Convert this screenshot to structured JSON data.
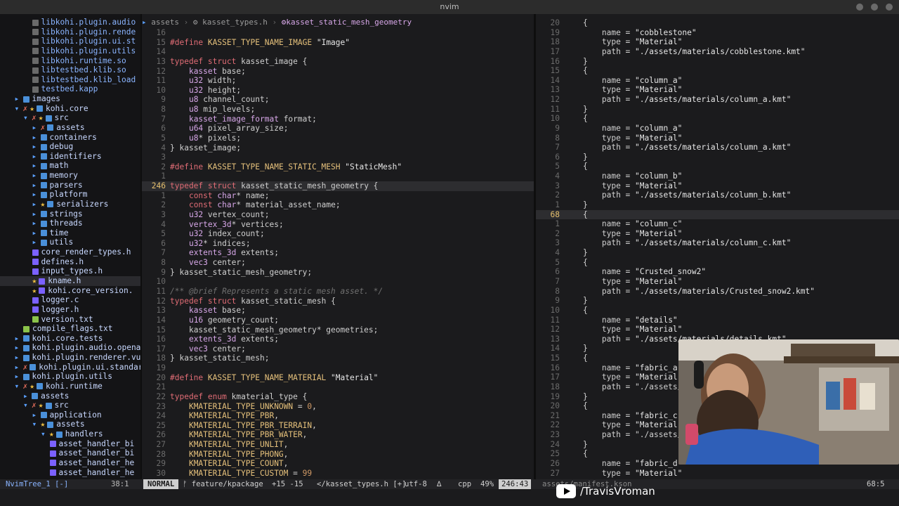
{
  "window": {
    "title": "nvim",
    "accent": "#e6c06e"
  },
  "tree": {
    "items": [
      {
        "indent": 3,
        "kind": "so",
        "label": "libkohi.plugin.audio"
      },
      {
        "indent": 3,
        "kind": "so",
        "label": "libkohi.plugin.rende"
      },
      {
        "indent": 3,
        "kind": "so",
        "label": "libkohi.plugin.ui.st"
      },
      {
        "indent": 3,
        "kind": "so",
        "label": "libkohi.plugin.utils"
      },
      {
        "indent": 3,
        "kind": "so",
        "label": "libkohi.runtime.so"
      },
      {
        "indent": 3,
        "kind": "so",
        "label": "libtestbed.klib.so"
      },
      {
        "indent": 3,
        "kind": "so",
        "label": "libtestbed.klib_load"
      },
      {
        "indent": 3,
        "kind": "so",
        "label": "testbed.kapp"
      },
      {
        "indent": 1,
        "kind": "dir",
        "label": "images",
        "chev": "▸"
      },
      {
        "indent": 1,
        "kind": "dir",
        "label": "kohi.core",
        "chev": "▾",
        "mark": "✗★"
      },
      {
        "indent": 2,
        "kind": "dir",
        "label": "src",
        "chev": "▾",
        "mark": "✗★"
      },
      {
        "indent": 3,
        "kind": "dir",
        "label": "assets",
        "chev": "▸",
        "mark": "✗"
      },
      {
        "indent": 3,
        "kind": "dir",
        "label": "containers",
        "chev": "▸"
      },
      {
        "indent": 3,
        "kind": "dir",
        "label": "debug",
        "chev": "▸"
      },
      {
        "indent": 3,
        "kind": "dir",
        "label": "identifiers",
        "chev": "▸"
      },
      {
        "indent": 3,
        "kind": "dir",
        "label": "math",
        "chev": "▸"
      },
      {
        "indent": 3,
        "kind": "dir",
        "label": "memory",
        "chev": "▸"
      },
      {
        "indent": 3,
        "kind": "dir",
        "label": "parsers",
        "chev": "▸"
      },
      {
        "indent": 3,
        "kind": "dir",
        "label": "platform",
        "chev": "▸"
      },
      {
        "indent": 3,
        "kind": "dir",
        "label": "serializers",
        "chev": "▸",
        "mark": "★"
      },
      {
        "indent": 3,
        "kind": "dir",
        "label": "strings",
        "chev": "▸"
      },
      {
        "indent": 3,
        "kind": "dir",
        "label": "threads",
        "chev": "▸"
      },
      {
        "indent": 3,
        "kind": "dir",
        "label": "time",
        "chev": "▸"
      },
      {
        "indent": 3,
        "kind": "dir",
        "label": "utils",
        "chev": "▸"
      },
      {
        "indent": 3,
        "kind": "h",
        "label": "core_render_types.h"
      },
      {
        "indent": 3,
        "kind": "h",
        "label": "defines.h"
      },
      {
        "indent": 3,
        "kind": "h",
        "label": "input_types.h"
      },
      {
        "indent": 3,
        "kind": "h",
        "label": "kname.h",
        "mark": "★",
        "sel": true
      },
      {
        "indent": 3,
        "kind": "h",
        "label": "kohi.core_version.",
        "mark": "★"
      },
      {
        "indent": 3,
        "kind": "c",
        "label": "logger.c"
      },
      {
        "indent": 3,
        "kind": "h",
        "label": "logger.h"
      },
      {
        "indent": 3,
        "kind": "txt",
        "label": "version.txt"
      },
      {
        "indent": 2,
        "kind": "txt",
        "label": "compile_flags.txt"
      },
      {
        "indent": 1,
        "kind": "dir",
        "label": "kohi.core.tests",
        "chev": "▸"
      },
      {
        "indent": 1,
        "kind": "dir",
        "label": "kohi.plugin.audio.openal",
        "chev": "▸"
      },
      {
        "indent": 1,
        "kind": "dir",
        "label": "kohi.plugin.renderer.vul",
        "chev": "▸"
      },
      {
        "indent": 1,
        "kind": "dir",
        "label": "kohi.plugin.ui.standar",
        "chev": "▸",
        "mark": "✗"
      },
      {
        "indent": 1,
        "kind": "dir",
        "label": "kohi.plugin.utils",
        "chev": "▸"
      },
      {
        "indent": 1,
        "kind": "dir",
        "label": "kohi.runtime",
        "chev": "▾",
        "mark": "✗★"
      },
      {
        "indent": 2,
        "kind": "dir",
        "label": "assets",
        "chev": "▸"
      },
      {
        "indent": 2,
        "kind": "dir",
        "label": "src",
        "chev": "▾",
        "mark": "✗★"
      },
      {
        "indent": 3,
        "kind": "dir",
        "label": "application",
        "chev": "▸"
      },
      {
        "indent": 3,
        "kind": "dir",
        "label": "assets",
        "chev": "▾",
        "mark": "★"
      },
      {
        "indent": 4,
        "kind": "dir",
        "label": "handlers",
        "chev": "▾",
        "mark": "★"
      },
      {
        "indent": 5,
        "kind": "c",
        "label": "asset_handler_bi"
      },
      {
        "indent": 5,
        "kind": "c",
        "label": "asset_handler_bi"
      },
      {
        "indent": 5,
        "kind": "c",
        "label": "asset_handler_he"
      },
      {
        "indent": 5,
        "kind": "c",
        "label": "asset_handler_he"
      }
    ]
  },
  "left_editor": {
    "breadcrumb": [
      "assets",
      "kasset_types.h",
      "kasset_static_mesh_geometry"
    ],
    "lines": [
      {
        "n": "16",
        "code": ""
      },
      {
        "n": "15",
        "code": "#define KASSET_TYPE_NAME_IMAGE \"Image\""
      },
      {
        "n": "14",
        "code": ""
      },
      {
        "n": "13",
        "code": "typedef struct kasset_image {"
      },
      {
        "n": "12",
        "code": "    kasset base;"
      },
      {
        "n": "11",
        "code": "    u32 width;"
      },
      {
        "n": "10",
        "code": "    u32 height;"
      },
      {
        "n": "9",
        "code": "    u8 channel_count;"
      },
      {
        "n": "8",
        "code": "    u8 mip_levels;"
      },
      {
        "n": "7",
        "code": "    kasset_image_format format;"
      },
      {
        "n": "6",
        "code": "    u64 pixel_array_size;"
      },
      {
        "n": "5",
        "code": "    u8* pixels;"
      },
      {
        "n": "4",
        "code": "} kasset_image;"
      },
      {
        "n": "3",
        "code": ""
      },
      {
        "n": "2",
        "code": "#define KASSET_TYPE_NAME_STATIC_MESH \"StaticMesh\""
      },
      {
        "n": "1",
        "code": ""
      },
      {
        "n": "246",
        "code": "typedef struct kasset_static_mesh_geometry {",
        "cur": true
      },
      {
        "n": "1",
        "code": "    const char* name;"
      },
      {
        "n": "2",
        "code": "    const char* material_asset_name;"
      },
      {
        "n": "3",
        "code": "    u32 vertex_count;"
      },
      {
        "n": "4",
        "code": "    vertex_3d* vertices;"
      },
      {
        "n": "5",
        "code": "    u32 index_count;"
      },
      {
        "n": "6",
        "code": "    u32* indices;"
      },
      {
        "n": "7",
        "code": "    extents_3d extents;"
      },
      {
        "n": "8",
        "code": "    vec3 center;"
      },
      {
        "n": "9",
        "code": "} kasset_static_mesh_geometry;"
      },
      {
        "n": "10",
        "code": ""
      },
      {
        "n": "11",
        "code": "/** @brief Represents a static mesh asset. */"
      },
      {
        "n": "12",
        "code": "typedef struct kasset_static_mesh {"
      },
      {
        "n": "13",
        "code": "    kasset base;"
      },
      {
        "n": "14",
        "code": "    u16 geometry_count;"
      },
      {
        "n": "15",
        "code": "    kasset_static_mesh_geometry* geometries;"
      },
      {
        "n": "16",
        "code": "    extents_3d extents;"
      },
      {
        "n": "17",
        "code": "    vec3 center;"
      },
      {
        "n": "18",
        "code": "} kasset_static_mesh;"
      },
      {
        "n": "19",
        "code": ""
      },
      {
        "n": "20",
        "code": "#define KASSET_TYPE_NAME_MATERIAL \"Material\""
      },
      {
        "n": "21",
        "code": ""
      },
      {
        "n": "22",
        "code": "typedef enum kmaterial_type {"
      },
      {
        "n": "23",
        "code": "    KMATERIAL_TYPE_UNKNOWN = 0,"
      },
      {
        "n": "24",
        "code": "    KMATERIAL_TYPE_PBR,"
      },
      {
        "n": "25",
        "code": "    KMATERIAL_TYPE_PBR_TERRAIN,"
      },
      {
        "n": "26",
        "code": "    KMATERIAL_TYPE_PBR_WATER,"
      },
      {
        "n": "27",
        "code": "    KMATERIAL_TYPE_UNLIT,"
      },
      {
        "n": "28",
        "code": "    KMATERIAL_TYPE_PHONG,"
      },
      {
        "n": "29",
        "code": "    KMATERIAL_TYPE_COUNT,"
      },
      {
        "n": "30",
        "code": "    KMATERIAL_TYPE_CUSTOM = 99"
      }
    ]
  },
  "right_editor": {
    "lines": [
      {
        "n": "20",
        "code": "    {"
      },
      {
        "n": "19",
        "code": "        name = \"cobblestone\""
      },
      {
        "n": "18",
        "code": "        type = \"Material\""
      },
      {
        "n": "17",
        "code": "        path = \"./assets/materials/cobblestone.kmt\""
      },
      {
        "n": "16",
        "code": "    }"
      },
      {
        "n": "15",
        "code": "    {"
      },
      {
        "n": "14",
        "code": "        name = \"column_a\""
      },
      {
        "n": "13",
        "code": "        type = \"Material\""
      },
      {
        "n": "12",
        "code": "        path = \"./assets/materials/column_a.kmt\""
      },
      {
        "n": "11",
        "code": "    }"
      },
      {
        "n": "10",
        "code": "    {"
      },
      {
        "n": "9",
        "code": "        name = \"column_a\""
      },
      {
        "n": "8",
        "code": "        type = \"Material\""
      },
      {
        "n": "7",
        "code": "        path = \"./assets/materials/column_a.kmt\""
      },
      {
        "n": "6",
        "code": "    }"
      },
      {
        "n": "5",
        "code": "    {"
      },
      {
        "n": "4",
        "code": "        name = \"column_b\""
      },
      {
        "n": "3",
        "code": "        type = \"Material\""
      },
      {
        "n": "2",
        "code": "        path = \"./assets/materials/column_b.kmt\""
      },
      {
        "n": "1",
        "code": "    }"
      },
      {
        "n": "68",
        "code": "    {",
        "cur": true
      },
      {
        "n": "1",
        "code": "        name = \"column_c\""
      },
      {
        "n": "2",
        "code": "        type = \"Material\""
      },
      {
        "n": "3",
        "code": "        path = \"./assets/materials/column_c.kmt\""
      },
      {
        "n": "4",
        "code": "    }"
      },
      {
        "n": "5",
        "code": "    {"
      },
      {
        "n": "6",
        "code": "        name = \"Crusted_snow2\""
      },
      {
        "n": "7",
        "code": "        type = \"Material\""
      },
      {
        "n": "8",
        "code": "        path = \"./assets/materials/Crusted_snow2.kmt\""
      },
      {
        "n": "9",
        "code": "    }"
      },
      {
        "n": "10",
        "code": "    {"
      },
      {
        "n": "11",
        "code": "        name = \"details\""
      },
      {
        "n": "12",
        "code": "        type = \"Material\""
      },
      {
        "n": "13",
        "code": "        path = \"./assets/materials/details.kmt\""
      },
      {
        "n": "14",
        "code": "    }"
      },
      {
        "n": "15",
        "code": "    {"
      },
      {
        "n": "16",
        "code": "        name = \"fabric_a\""
      },
      {
        "n": "17",
        "code": "        type = \"Material\""
      },
      {
        "n": "18",
        "code": "        path = \"./assets/m"
      },
      {
        "n": "19",
        "code": "    }"
      },
      {
        "n": "20",
        "code": "    {"
      },
      {
        "n": "21",
        "code": "        name = \"fabric_c\""
      },
      {
        "n": "22",
        "code": "        type = \"Material\""
      },
      {
        "n": "23",
        "code": "        path = \"./assets/m"
      },
      {
        "n": "24",
        "code": "    }"
      },
      {
        "n": "25",
        "code": "    {"
      },
      {
        "n": "26",
        "code": "        name = \"fabric_d\""
      },
      {
        "n": "27",
        "code": "        type = \"Material\""
      }
    ]
  },
  "status": {
    "tree_name": "NvimTree_1 [-]",
    "tree_pos": "38:1",
    "mode": "NORMAL",
    "branch": "ᚠ feature/kpackage",
    "diff": "+15 -15",
    "file": "</kasset_types.h [+]",
    "encoding": "utf-8",
    "os_icon": "∆",
    "filetype": "cpp",
    "percent": "49%",
    "position": "246:43",
    "right_file": "assets/manifest.kson",
    "right_pos": "68:5"
  },
  "watermark": {
    "handle": "/TravisVroman"
  }
}
